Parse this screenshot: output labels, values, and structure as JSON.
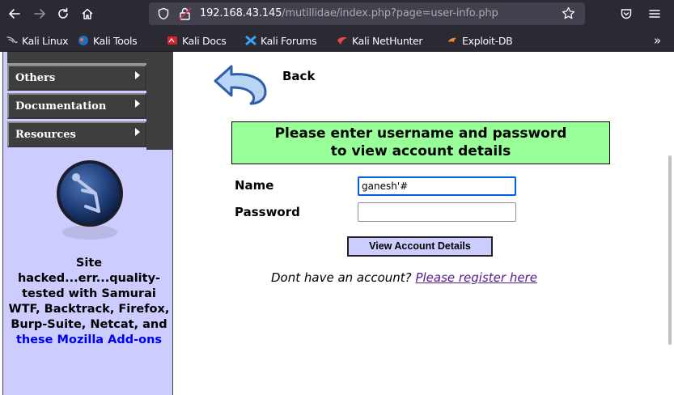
{
  "browser": {
    "url_host": "192.168.43.145",
    "url_path": "/mutillidae/index.php?page=user-info.php",
    "bookmarks": [
      {
        "label": "Kali Linux",
        "icon": "kali-dragon-icon"
      },
      {
        "label": "Kali Tools",
        "icon": "kali-tools-icon"
      },
      {
        "label": "Kali Docs",
        "icon": "kali-docs-icon"
      },
      {
        "label": "Kali Forums",
        "icon": "kali-forums-icon"
      },
      {
        "label": "Kali NetHunter",
        "icon": "kali-nethunter-icon"
      },
      {
        "label": "Exploit-DB",
        "icon": "exploit-db-icon"
      }
    ],
    "overflow": "»"
  },
  "sidebar": {
    "menu": [
      {
        "label": "Others"
      },
      {
        "label": "Documentation"
      },
      {
        "label": "Resources"
      }
    ],
    "message_text": "Site hacked...err...quality-tested with Samurai WTF, Backtrack, Firefox, Burp-Suite, Netcat, and",
    "message_link": "these Mozilla Add-ons"
  },
  "content": {
    "back_label": "Back",
    "instructions_line1": "Please enter username and password",
    "instructions_line2": "to view account details",
    "name_label": "Name",
    "name_value": "ganesh'#",
    "password_label": "Password",
    "password_value": "",
    "submit_label": "View Account Details",
    "register_text": "Dont have an account?",
    "register_link": "Please register here"
  },
  "colors": {
    "sidebar_bg": "#ccccff",
    "info_box_bg": "#99ff99",
    "menu_bg": "#3e3e3e",
    "link": "#551a8b"
  }
}
